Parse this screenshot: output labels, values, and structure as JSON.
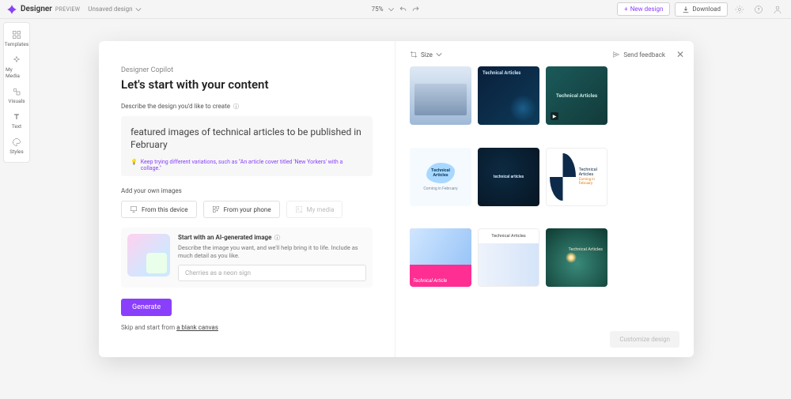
{
  "app": {
    "name": "Designer",
    "badge": "PREVIEW",
    "doc": "Unsaved design"
  },
  "topbar": {
    "zoom": "75%",
    "newDesign": "New design",
    "download": "Download"
  },
  "sidebar": {
    "items": [
      {
        "label": "Templates"
      },
      {
        "label": "My Media"
      },
      {
        "label": "Visuals"
      },
      {
        "label": "Text"
      },
      {
        "label": "Styles"
      }
    ]
  },
  "modal": {
    "copilotLabel": "Designer Copilot",
    "headline": "Let's start with your content",
    "describeLabel": "Describe the design you'd like to create",
    "prompt": "featured images of technical articles to be published in February",
    "tip": "Keep trying different variations, such as \"An article cover titled 'New Yorkers' with a collage.\"",
    "addImagesLabel": "Add your own images",
    "uploads": {
      "device": "From this device",
      "phone": "From your phone",
      "media": "My media"
    },
    "ai": {
      "title": "Start with an AI-generated image",
      "desc": "Describe the image you want, and we'll help bring it to life. Include as much detail as you like.",
      "placeholder": "Cherries as a neon sign"
    },
    "generate": "Generate",
    "skipPrefix": "Skip and start from ",
    "skipLink": "a blank canvas"
  },
  "right": {
    "size": "Size",
    "feedback": "Send feedback",
    "customize": "Customize design",
    "cards": [
      {
        "name": "card-1",
        "text": ""
      },
      {
        "name": "card-2",
        "text": "Technical Articles"
      },
      {
        "name": "card-3",
        "text": "Technical Articles"
      },
      {
        "name": "card-4",
        "text": "Technical Articles",
        "sub": "Coming in February"
      },
      {
        "name": "card-5",
        "text": "technical articles"
      },
      {
        "name": "card-6",
        "text": "Technical Articles",
        "sub": "Coming in February"
      },
      {
        "name": "card-7",
        "text": "Technical Article"
      },
      {
        "name": "card-8",
        "text": "Technical Articles"
      },
      {
        "name": "card-9",
        "text": "Technical Articles"
      }
    ]
  }
}
